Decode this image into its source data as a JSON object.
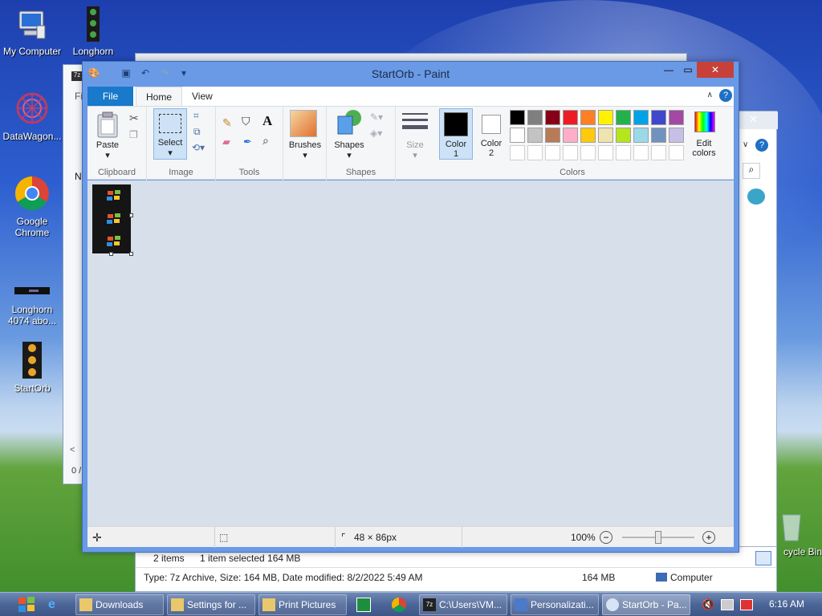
{
  "desktop": {
    "icons": [
      {
        "label": "My Computer"
      },
      {
        "label": "Longhorn"
      },
      {
        "label": "DataWagon..."
      },
      {
        "label": "Google Chrome"
      },
      {
        "label": "Longhorn 4074 abo..."
      },
      {
        "label": "StartOrb"
      },
      {
        "label": "cycle Bin"
      }
    ]
  },
  "explorer": {
    "status_items": "2 items",
    "status_selected": "1 item selected  164 MB",
    "details": "Type: 7z Archive, Size: 164 MB, Date modified: 8/2/2022 5:49 AM",
    "details_size": "164 MB",
    "details_location": "Computer",
    "left_status": "0 /",
    "col_header": "N"
  },
  "paint": {
    "title": "StartOrb - Paint",
    "tabs": [
      "File",
      "Home",
      "View"
    ],
    "groups": {
      "clipboard": "Clipboard",
      "image": "Image",
      "tools": "Tools",
      "shapes": "Shapes",
      "colors": "Colors"
    },
    "buttons": {
      "paste": "Paste",
      "select": "Select",
      "brushes": "Brushes",
      "shapes": "Shapes",
      "size": "Size",
      "color1": "Color 1",
      "color1_num": "1",
      "color1_word": "Color",
      "color2_word": "Color",
      "color2_num": "2",
      "edit_colors_1": "Edit",
      "edit_colors_2": "colors"
    },
    "palette_row1": [
      "#000000",
      "#7f7f7f",
      "#880015",
      "#ed1c24",
      "#ff7f27",
      "#fff200",
      "#22b14c",
      "#00a2e8",
      "#3f48cc",
      "#a349a4"
    ],
    "palette_row2": [
      "#ffffff",
      "#c3c3c3",
      "#b97a57",
      "#ffaec9",
      "#ffc90e",
      "#efe4b0",
      "#b5e61d",
      "#99d9ea",
      "#7092be",
      "#c8bfe7"
    ],
    "color1_value": "#000000",
    "color2_value": "#ffffff",
    "status": {
      "dimensions": "48 × 86px",
      "zoom": "100%",
      "zoom_level": 0.5
    }
  },
  "taskbar": {
    "items": [
      {
        "label": "Downloads"
      },
      {
        "label": "Settings for ..."
      },
      {
        "label": "Print Pictures"
      },
      {
        "label": "C:\\Users\\VM..."
      },
      {
        "label": "Personalizati..."
      },
      {
        "label": "StartOrb - Pa..."
      }
    ],
    "clock": "6:16 AM"
  }
}
